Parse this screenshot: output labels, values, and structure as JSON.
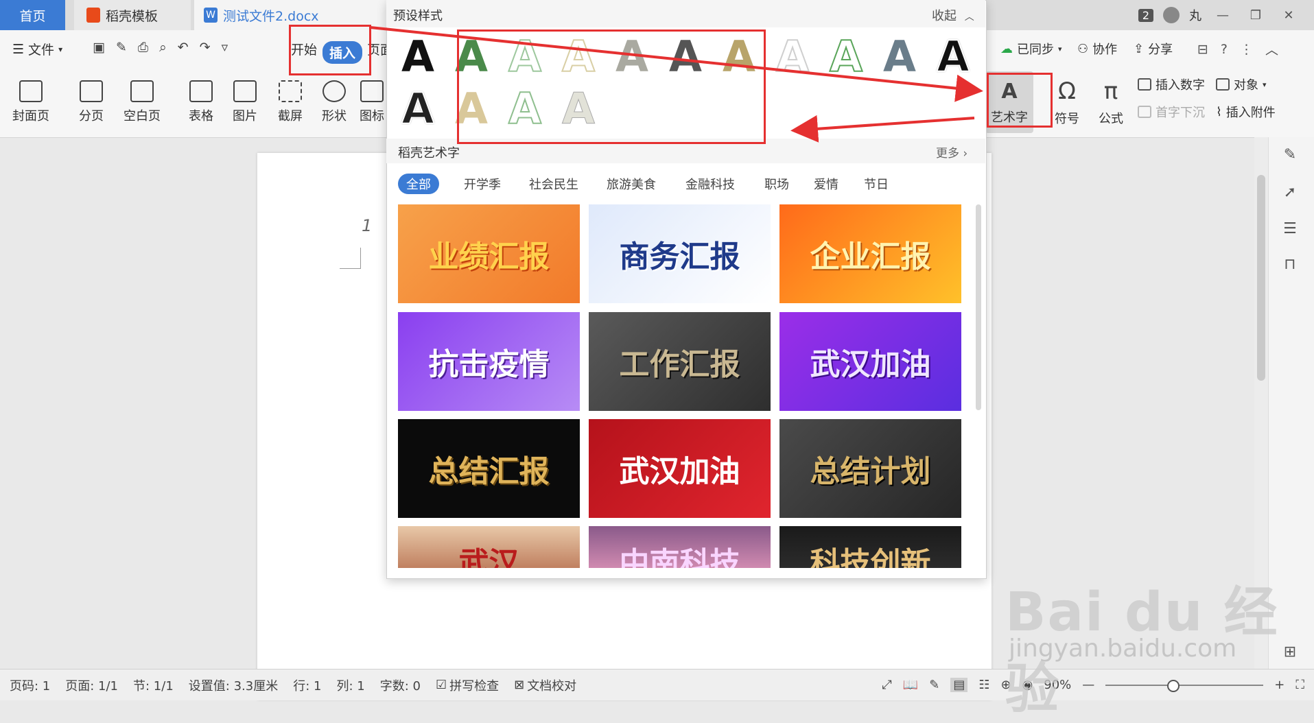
{
  "tabs": {
    "home": "首页",
    "template": "稻壳模板",
    "document": "测试文件2.docx"
  },
  "titlebar": {
    "badge": "2",
    "user": "丸"
  },
  "menubar": {
    "file": "文件",
    "start": "开始",
    "insert": "插入",
    "page": "页面",
    "synced": "已同步",
    "collab": "协作",
    "share": "分享"
  },
  "ribbon": {
    "cover": "封面页",
    "pagebreak": "分页",
    "blank": "空白页",
    "table": "表格",
    "picture": "图片",
    "screenshot": "截屏",
    "shape": "形状",
    "icon": "图标",
    "wordart": "艺术字",
    "symbol": "符号",
    "formula": "公式",
    "insert_number": "插入数字",
    "object": "对象",
    "dropcap": "首字下沉",
    "attachment": "插入附件"
  },
  "panel": {
    "preset_title": "预设样式",
    "collapse": "收起",
    "gallery_title": "稻壳艺术字",
    "more": "更多",
    "categories": [
      "全部",
      "开学季",
      "社会民生",
      "旅游美食",
      "金融科技",
      "职场",
      "爱情",
      "节日"
    ],
    "cards": [
      "业绩汇报",
      "商务汇报",
      "企业汇报",
      "抗击疫情",
      "工作汇报",
      "武汉加油",
      "总结汇报",
      "武汉加油",
      "总结计划",
      "武汉",
      "中南科技",
      "科技创新"
    ]
  },
  "document": {
    "page_number": "1"
  },
  "statusbar": {
    "page_code": "页码: 1",
    "page": "页面: 1/1",
    "section": "节: 1/1",
    "setting": "设置值: 3.3厘米",
    "row": "行: 1",
    "col": "列: 1",
    "wordcount": "字数: 0",
    "spellcheck": "拼写检查",
    "proofread": "文档校对",
    "zoom": "90%"
  },
  "watermark": {
    "logo": "Bai du 经验",
    "url": "jingyan.baidu.com"
  },
  "colors": {
    "accent": "#3b7bd4",
    "annotation": "#e53030"
  }
}
